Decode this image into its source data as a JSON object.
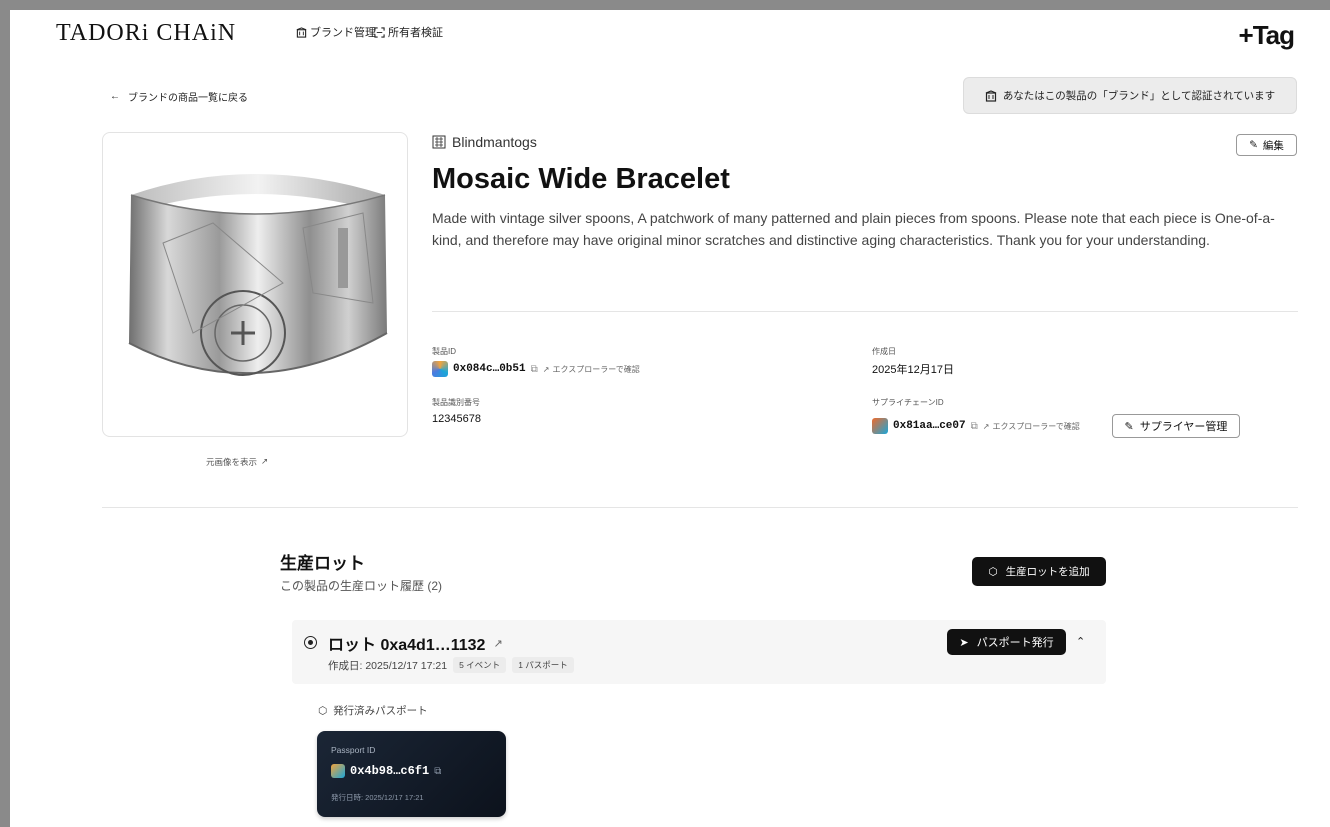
{
  "header": {
    "logo": "TADORi CHAiN",
    "nav": [
      {
        "label": "ブランド管理",
        "icon": "building-icon"
      },
      {
        "label": "所有者検証",
        "icon": "scan-icon"
      }
    ],
    "right_logo": "+Tag"
  },
  "back_link": "ブランドの商品一覧に戻る",
  "verified_badge": "あなたはこの製品の「ブランド」として認証されています",
  "view_original": "元画像を表示",
  "product": {
    "brand": "Blindmantogs",
    "title": "Mosaic Wide Bracelet",
    "description": "Made with vintage silver spoons, A patchwork of many patterned and plain pieces from spoons. Please note that each piece is One-of-a-kind, and therefore may have original minor scratches and distinctive aging characteristics. Thank you for your understanding.",
    "edit_label": "編集"
  },
  "meta": {
    "product_id_label": "製品ID",
    "product_id": "0x084c…0b51",
    "explorer_link": "エクスプローラーで確認",
    "serial_label": "製品識別番号",
    "serial": "12345678",
    "created_label": "作成日",
    "created": "2025年12月17日",
    "supply_chain_label": "サプライチェーンID",
    "supply_chain_id": "0x81aa…ce07",
    "supplier_button": "サプライヤー管理"
  },
  "lots": {
    "title": "生産ロット",
    "subtitle": "この製品の生産ロット履歴 (2)",
    "add_button": "生産ロットを追加",
    "items": [
      {
        "name": "ロット 0xa4d1…1132",
        "created": "作成日: 2025/12/17 17:21",
        "events": "5 イベント",
        "passports": "1 パスポート",
        "issue_button": "パスポート発行"
      }
    ],
    "issued_label": "発行済みパスポート",
    "passport": {
      "label": "Passport ID",
      "id": "0x4b98…c6f1",
      "issued": "発行日時: 2025/12/17 17:21"
    }
  }
}
